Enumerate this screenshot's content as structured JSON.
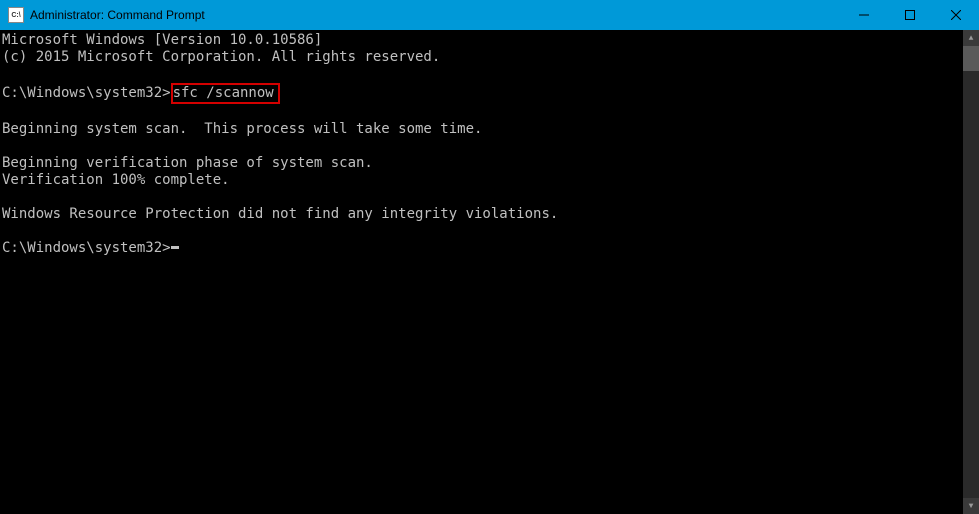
{
  "titlebar": {
    "title": "Administrator: Command Prompt"
  },
  "terminal": {
    "line1": "Microsoft Windows [Version 10.0.10586]",
    "line2": "(c) 2015 Microsoft Corporation. All rights reserved.",
    "prompt1_path": "C:\\Windows\\system32>",
    "command": "sfc /scannow",
    "line_scan": "Beginning system scan.  This process will take some time.",
    "line_verify1": "Beginning verification phase of system scan.",
    "line_verify2": "Verification 100% complete.",
    "line_result": "Windows Resource Protection did not find any integrity violations.",
    "prompt2_path": "C:\\Windows\\system32>"
  }
}
